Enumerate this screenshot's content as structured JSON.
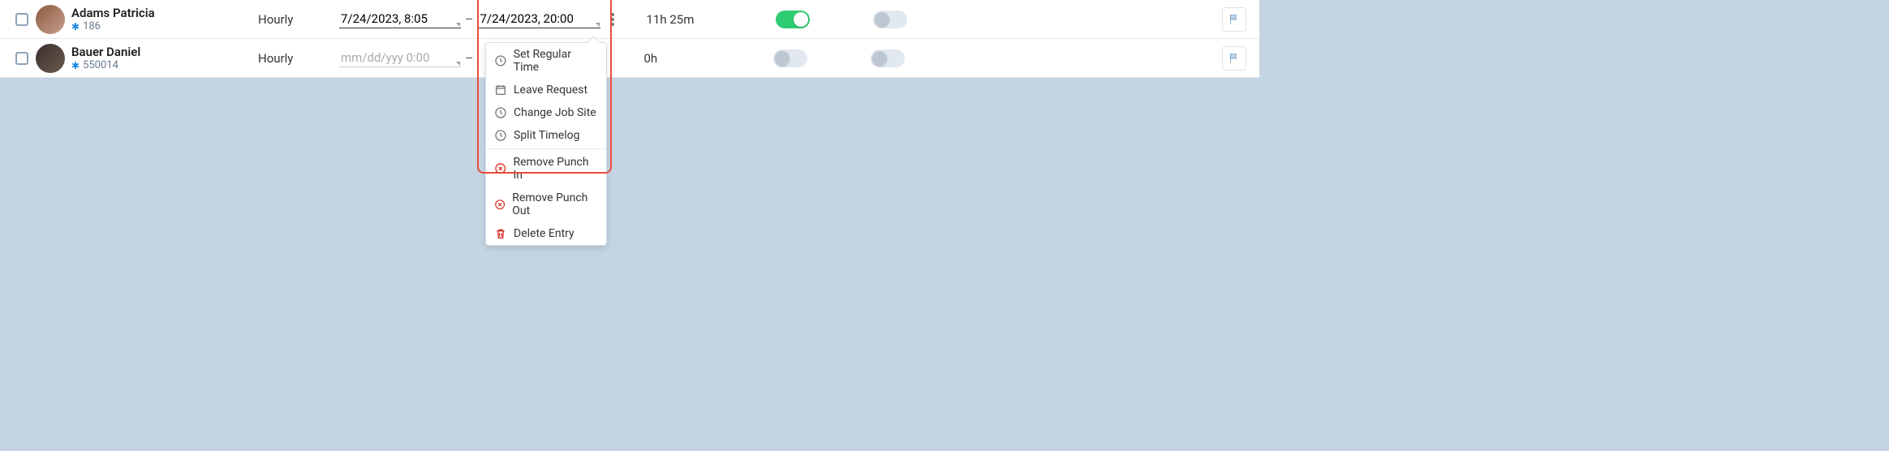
{
  "rows": [
    {
      "name": "Adams Patricia",
      "emp_id": "186",
      "paytype": "Hourly",
      "punch_in": "7/24/2023, 8:05",
      "punch_out": "7/24/2023, 20:00",
      "total": "11h 25m",
      "toggle1_on": true,
      "toggle2_on": false
    },
    {
      "name": "Bauer Daniel",
      "emp_id": "550014",
      "paytype": "Hourly",
      "punch_in_placeholder": "mm/dd/yyy   0:00",
      "punch_out_placeholder": "",
      "total": "0h",
      "toggle1_on": false,
      "toggle2_on": false
    }
  ],
  "menu": {
    "set_regular": "Set Regular Time",
    "leave_request": "Leave Request",
    "change_job": "Change Job Site",
    "split": "Split Timelog",
    "remove_in": "Remove Punch In",
    "remove_out": "Remove Punch Out",
    "delete": "Delete Entry"
  }
}
